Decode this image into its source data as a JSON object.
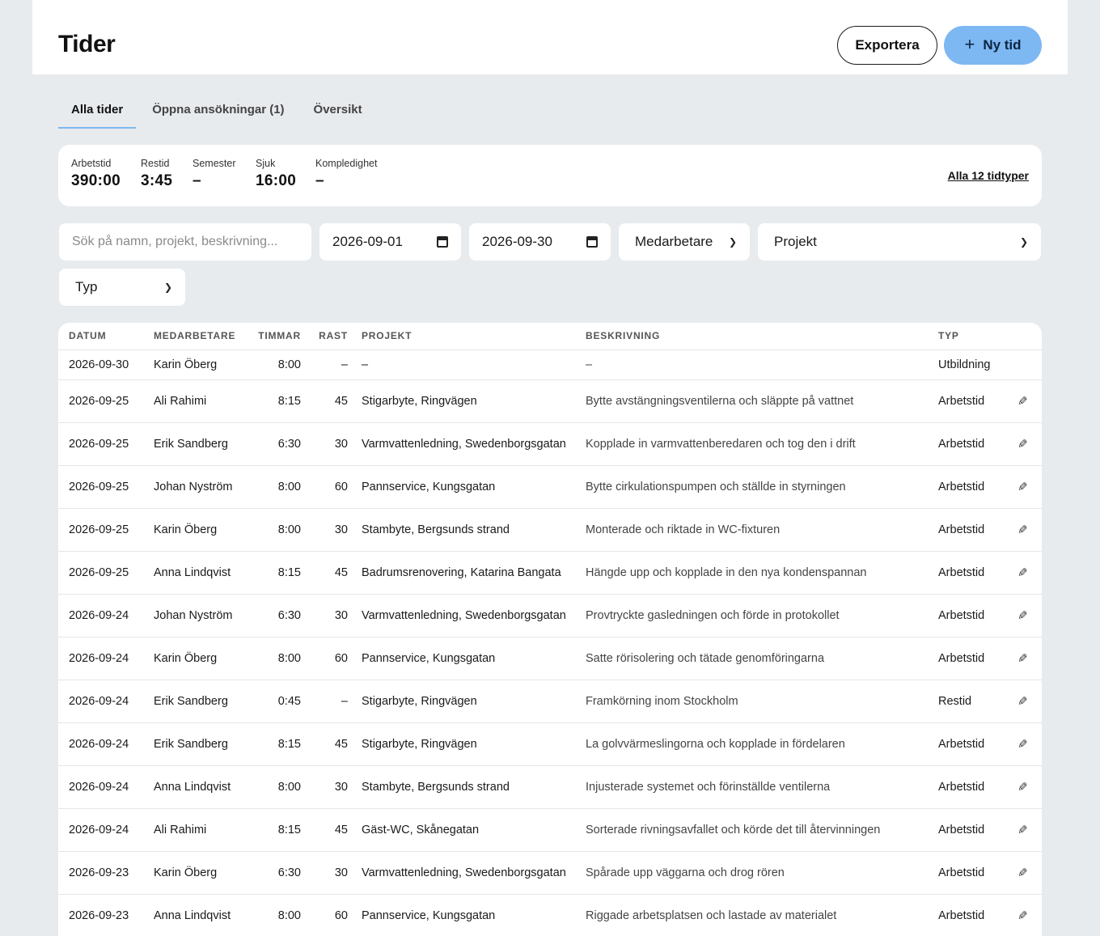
{
  "header": {
    "title": "Tider",
    "export_label": "Exportera",
    "new_label": "Ny tid",
    "new_icon": "plus-icon"
  },
  "tabs": [
    {
      "label": "Alla tider",
      "active": true
    },
    {
      "label": "Öppna ansökningar (1)",
      "active": false
    },
    {
      "label": "Översikt",
      "active": false
    }
  ],
  "summary": {
    "stats": [
      {
        "label": "Arbetstid",
        "value": "390:00"
      },
      {
        "label": "Restid",
        "value": "3:45"
      },
      {
        "label": "Semester",
        "value": "–"
      },
      {
        "label": "Sjuk",
        "value": "16:00"
      },
      {
        "label": "Kompledighet",
        "value": "–"
      }
    ],
    "all_types_link": "Alla 12 tidtyper"
  },
  "filters": {
    "search_placeholder": "Sök på namn, projekt, beskrivning...",
    "date_from": "2026-09-01",
    "date_to": "2026-09-30",
    "employee": "Medarbetare",
    "project": "Projekt",
    "type": "Typ"
  },
  "table": {
    "columns": [
      "DATUM",
      "MEDARBETARE",
      "TIMMAR",
      "RAST",
      "PROJEKT",
      "BESKRIVNING",
      "TYP"
    ],
    "rows": [
      {
        "date": "2026-09-30",
        "employee": "Karin Öberg",
        "hours": "8:00",
        "break": "–",
        "project": "–",
        "description": "–",
        "type": "Utbildning",
        "editable": false
      },
      {
        "date": "2026-09-25",
        "employee": "Ali Rahimi",
        "hours": "8:15",
        "break": "45",
        "project": "Stigarbyte, Ringvägen",
        "description": "Bytte avstängningsventilerna och släppte på vattnet",
        "type": "Arbetstid",
        "editable": true
      },
      {
        "date": "2026-09-25",
        "employee": "Erik Sandberg",
        "hours": "6:30",
        "break": "30",
        "project": "Varmvattenledning, Swedenborgsgatan",
        "description": "Kopplade in varmvattenberedaren och tog den i drift",
        "type": "Arbetstid",
        "editable": true
      },
      {
        "date": "2026-09-25",
        "employee": "Johan Nyström",
        "hours": "8:00",
        "break": "60",
        "project": "Pannservice, Kungsgatan",
        "description": "Bytte cirkulationspumpen och ställde in styrningen",
        "type": "Arbetstid",
        "editable": true
      },
      {
        "date": "2026-09-25",
        "employee": "Karin Öberg",
        "hours": "8:00",
        "break": "30",
        "project": "Stambyte, Bergsunds strand",
        "description": "Monterade och riktade in WC-fixturen",
        "type": "Arbetstid",
        "editable": true
      },
      {
        "date": "2026-09-25",
        "employee": "Anna Lindqvist",
        "hours": "8:15",
        "break": "45",
        "project": "Badrumsrenovering, Katarina Bangata",
        "description": "Hängde upp och kopplade in den nya kondenspannan",
        "type": "Arbetstid",
        "editable": true
      },
      {
        "date": "2026-09-24",
        "employee": "Johan Nyström",
        "hours": "6:30",
        "break": "30",
        "project": "Varmvattenledning, Swedenborgsgatan",
        "description": "Provtryckte gasledningen och förde in protokollet",
        "type": "Arbetstid",
        "editable": true
      },
      {
        "date": "2026-09-24",
        "employee": "Karin Öberg",
        "hours": "8:00",
        "break": "60",
        "project": "Pannservice, Kungsgatan",
        "description": "Satte rörisolering och tätade genomföringarna",
        "type": "Arbetstid",
        "editable": true
      },
      {
        "date": "2026-09-24",
        "employee": "Erik Sandberg",
        "hours": "0:45",
        "break": "–",
        "project": "Stigarbyte, Ringvägen",
        "description": "Framkörning inom Stockholm",
        "type": "Restid",
        "editable": true
      },
      {
        "date": "2026-09-24",
        "employee": "Erik Sandberg",
        "hours": "8:15",
        "break": "45",
        "project": "Stigarbyte, Ringvägen",
        "description": "La golvvärmeslingorna och kopplade in fördelaren",
        "type": "Arbetstid",
        "editable": true
      },
      {
        "date": "2026-09-24",
        "employee": "Anna Lindqvist",
        "hours": "8:00",
        "break": "30",
        "project": "Stambyte, Bergsunds strand",
        "description": "Injusterade systemet och förinställde ventilerna",
        "type": "Arbetstid",
        "editable": true
      },
      {
        "date": "2026-09-24",
        "employee": "Ali Rahimi",
        "hours": "8:15",
        "break": "45",
        "project": "Gäst-WC, Skånegatan",
        "description": "Sorterade rivningsavfallet och körde det till återvinningen",
        "type": "Arbetstid",
        "editable": true
      },
      {
        "date": "2026-09-23",
        "employee": "Karin Öberg",
        "hours": "6:30",
        "break": "30",
        "project": "Varmvattenledning, Swedenborgsgatan",
        "description": "Spårade upp väggarna och drog rören",
        "type": "Arbetstid",
        "editable": true
      },
      {
        "date": "2026-09-23",
        "employee": "Anna Lindqvist",
        "hours": "8:00",
        "break": "60",
        "project": "Pannservice, Kungsgatan",
        "description": "Riggade arbetsplatsen och lastade av materialet",
        "type": "Arbetstid",
        "editable": true
      }
    ]
  }
}
